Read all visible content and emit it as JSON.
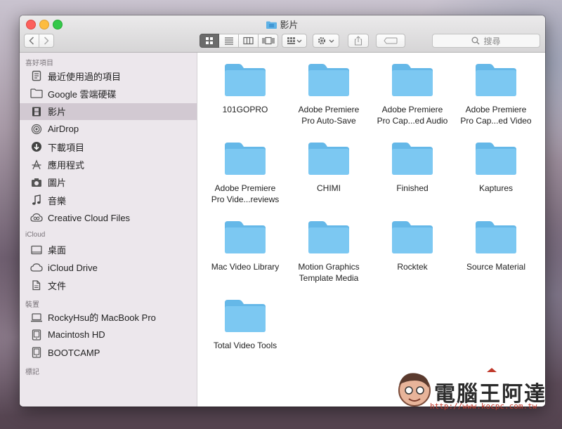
{
  "window": {
    "title": "影片"
  },
  "toolbar": {
    "view_modes": [
      "icon-view",
      "list-view",
      "column-view",
      "cover-flow-view"
    ],
    "active_view": 0,
    "search_placeholder": "搜尋"
  },
  "sidebar": {
    "sections": [
      {
        "title": "喜好項目",
        "items": [
          {
            "label": "最近使用過的項目",
            "icon": "recents-icon"
          },
          {
            "label": "Google 雲端硬碟",
            "icon": "folder-icon"
          },
          {
            "label": "影片",
            "icon": "movies-icon",
            "selected": true
          },
          {
            "label": "AirDrop",
            "icon": "airdrop-icon"
          },
          {
            "label": "下載項目",
            "icon": "downloads-icon"
          },
          {
            "label": "應用程式",
            "icon": "applications-icon"
          },
          {
            "label": "圖片",
            "icon": "camera-icon"
          },
          {
            "label": "音樂",
            "icon": "music-icon"
          },
          {
            "label": "Creative Cloud Files",
            "icon": "creative-cloud-icon"
          }
        ]
      },
      {
        "title": "iCloud",
        "items": [
          {
            "label": "桌面",
            "icon": "desktop-icon"
          },
          {
            "label": "iCloud Drive",
            "icon": "cloud-icon"
          },
          {
            "label": "文件",
            "icon": "documents-icon"
          }
        ]
      },
      {
        "title": "裝置",
        "items": [
          {
            "label": "RockyHsu的 MacBook Pro",
            "icon": "laptop-icon"
          },
          {
            "label": "Macintosh HD",
            "icon": "harddisk-icon"
          },
          {
            "label": "BOOTCAMP",
            "icon": "harddisk-icon"
          }
        ]
      },
      {
        "title": "標記",
        "items": []
      }
    ]
  },
  "folders": [
    [
      "101GOPRO",
      ""
    ],
    [
      "Adobe Premiere",
      "Pro Auto-Save"
    ],
    [
      "Adobe Premiere",
      "Pro Cap...ed Audio"
    ],
    [
      "Adobe Premiere",
      "Pro Cap...ed Video"
    ],
    [
      "Adobe Premiere",
      "Pro Vide...reviews"
    ],
    [
      "CHIMI",
      ""
    ],
    [
      "Finished",
      ""
    ],
    [
      "Kaptures",
      ""
    ],
    [
      "Mac Video Library",
      ""
    ],
    [
      "Motion Graphics",
      "Template Media"
    ],
    [
      "Rocktek",
      ""
    ],
    [
      "Source Material",
      ""
    ],
    [
      "Total Video Tools",
      ""
    ]
  ],
  "watermark": {
    "text": "電腦王阿達",
    "url": "http://www.kocpc.com.tw"
  },
  "colors": {
    "folder": "#7cc8f2",
    "folder_tab": "#65b8e8",
    "sidebar_selected": "#d2c9d2"
  }
}
